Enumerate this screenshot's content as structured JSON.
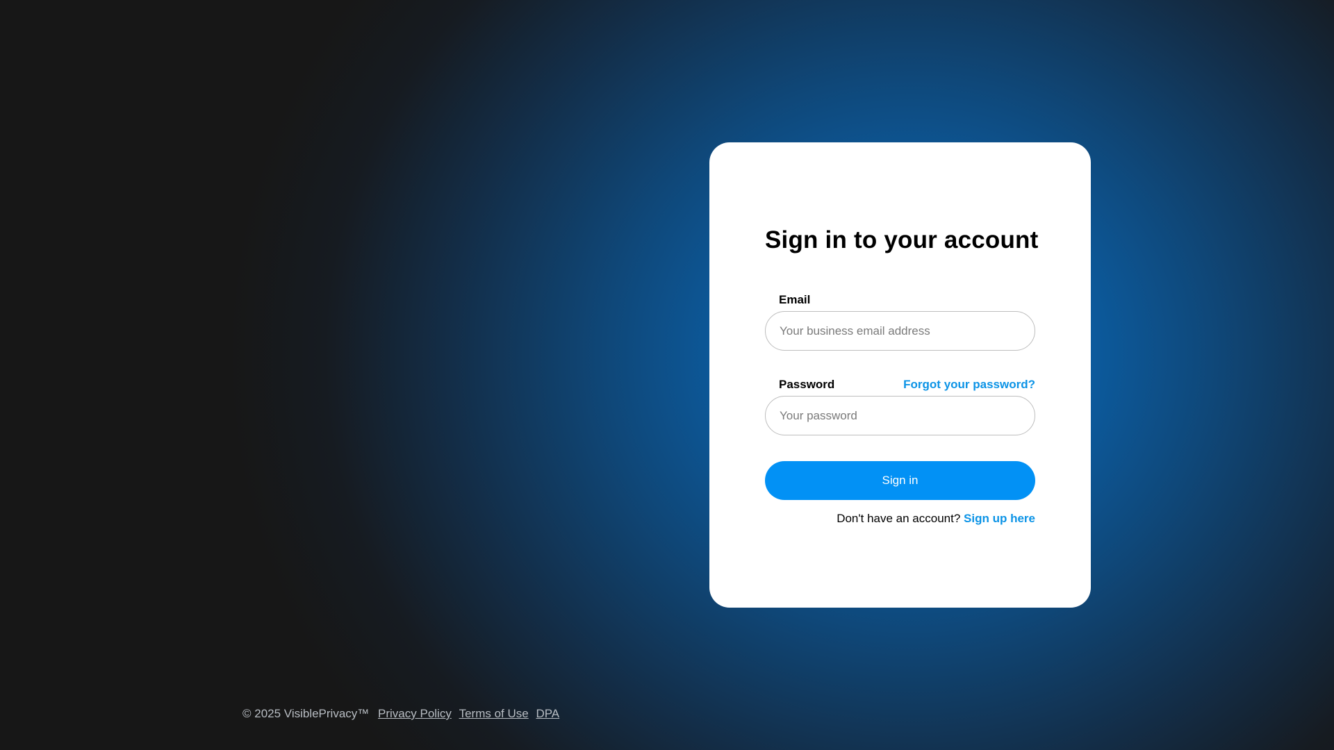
{
  "login": {
    "title": "Sign in to your account",
    "email_label": "Email",
    "email_placeholder": "Your business email address",
    "email_value": "",
    "password_label": "Password",
    "forgot_link": "Forgot your password?",
    "password_placeholder": "Your password",
    "password_value": "",
    "signin_button": "Sign in",
    "signup_prompt": "Don't have an account?",
    "signup_link": "Sign up here"
  },
  "footer": {
    "copyright": "© 2025 VisiblePrivacy™",
    "links": [
      "Privacy Policy",
      "Terms of Use",
      "DPA"
    ]
  },
  "colors": {
    "accent": "#0291f5",
    "link": "#0b93e6",
    "background_dark": "#171717",
    "background_glow": "#0a74c9"
  }
}
